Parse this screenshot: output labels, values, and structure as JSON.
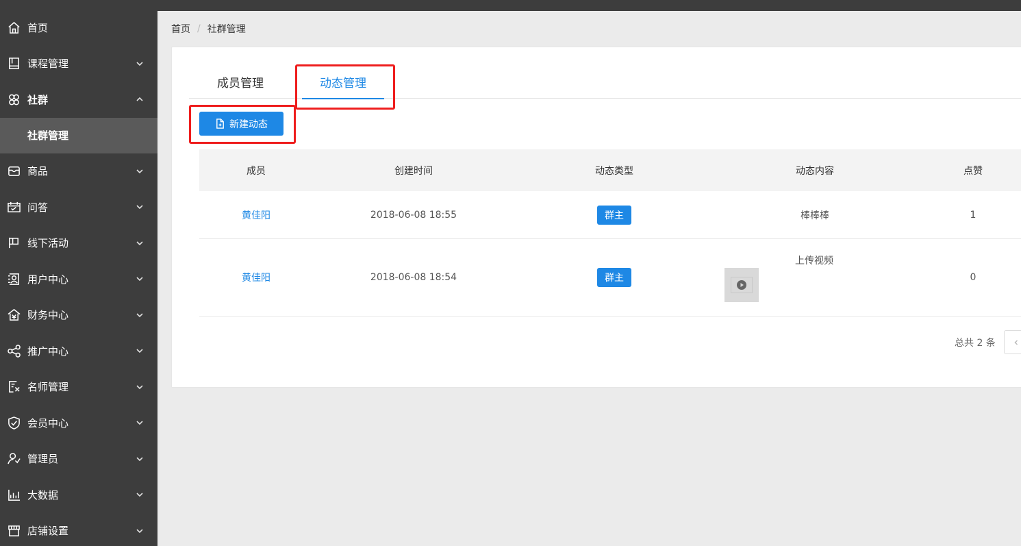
{
  "sidebar": {
    "items": [
      {
        "label": "首页",
        "icon": "home-icon"
      },
      {
        "label": "课程管理",
        "icon": "book-icon"
      },
      {
        "label": "社群",
        "icon": "community-icon"
      },
      {
        "label": "社群管理"
      },
      {
        "label": "商品",
        "icon": "shop-box-icon"
      },
      {
        "label": "问答",
        "icon": "calendar-qa-icon"
      },
      {
        "label": "线下活动",
        "icon": "flag-icon"
      },
      {
        "label": "用户中心",
        "icon": "user-card-icon"
      },
      {
        "label": "财务中心",
        "icon": "finance-home-icon"
      },
      {
        "label": "推广中心",
        "icon": "share-icon"
      },
      {
        "label": "名师管理",
        "icon": "teacher-doc-icon"
      },
      {
        "label": "会员中心",
        "icon": "shield-check-icon"
      },
      {
        "label": "管理员",
        "icon": "admin-user-icon"
      },
      {
        "label": "大数据",
        "icon": "bar-chart-icon"
      },
      {
        "label": "店铺设置",
        "icon": "store-icon"
      }
    ]
  },
  "breadcrumb": {
    "home": "首页",
    "separator": "/",
    "current": "社群管理"
  },
  "tabs": {
    "members": "成员管理",
    "posts": "动态管理"
  },
  "actions": {
    "new_post": "新建动态"
  },
  "table": {
    "headers": [
      "成员",
      "创建时间",
      "动态类型",
      "动态内容",
      "点赞"
    ],
    "rows": [
      {
        "member": "黄佳阳",
        "created": "2018-06-08 18:55",
        "type": "群主",
        "content": "棒棒棒",
        "likes": "1"
      },
      {
        "member": "黄佳阳",
        "created": "2018-06-08 18:54",
        "type": "群主",
        "content": "上传视频",
        "likes": "0"
      }
    ]
  },
  "pagination": {
    "total": "总共 2 条"
  },
  "colors": {
    "sidebar_bg": "#3d3d3d",
    "accent": "#1e88e5",
    "highlight_box": "#ee1d1d"
  }
}
